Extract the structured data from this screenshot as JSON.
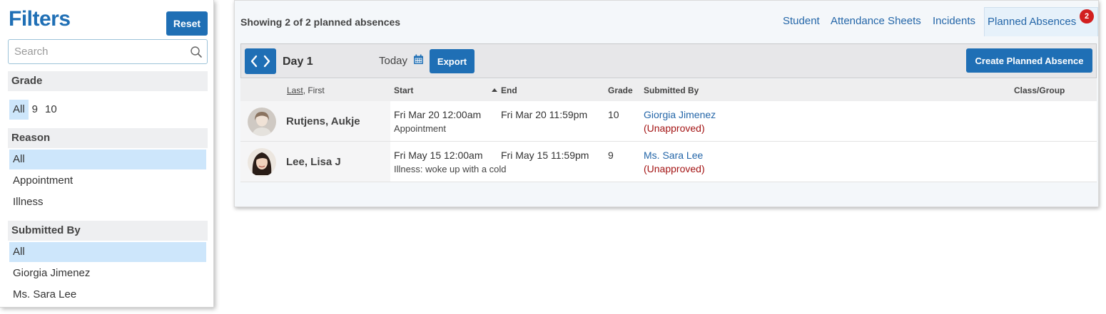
{
  "filters": {
    "title": "Filters",
    "reset_label": "Reset",
    "search_placeholder": "Search",
    "grade": {
      "heading": "Grade",
      "options": [
        "All",
        "9",
        "10"
      ],
      "selected": "All"
    },
    "reason": {
      "heading": "Reason",
      "options": [
        "All",
        "Appointment",
        "Illness"
      ],
      "selected": "All"
    },
    "submitted_by": {
      "heading": "Submitted By",
      "options": [
        "All",
        "Giorgia Jimenez",
        "Ms. Sara Lee"
      ],
      "selected": "All"
    }
  },
  "main": {
    "showing_text": "Showing 2 of 2 planned absences",
    "nav": [
      {
        "label": "Student"
      },
      {
        "label": "Attendance Sheets"
      },
      {
        "label": "Incidents"
      },
      {
        "label": "Planned Absences",
        "badge": "2",
        "active": true
      }
    ],
    "toolbar": {
      "day_label": "Day 1",
      "today_label": "Today",
      "export_label": "Export",
      "create_label": "Create Planned Absence"
    },
    "table": {
      "headers": {
        "last": "Last",
        "first": ", First",
        "start": "Start",
        "end": "End",
        "grade": "Grade",
        "submitted_by": "Submitted By",
        "class_group": "Class/Group"
      },
      "rows": [
        {
          "name": "Rutjens, Aukje",
          "start": "Fri Mar 20 12:00am",
          "end": "Fri Mar 20 11:59pm",
          "reason": "Appointment",
          "grade": "10",
          "submitter": "Giorgia Jimenez",
          "status": "(Unapproved)"
        },
        {
          "name": "Lee, Lisa J",
          "start": "Fri May 15 12:00am",
          "end": "Fri May 15 11:59pm",
          "reason": "Illness: woke up with a cold",
          "grade": "9",
          "submitter": "Ms. Sara Lee",
          "status": "(Unapproved)"
        }
      ]
    }
  },
  "colors": {
    "primary": "#1f6fb5",
    "link": "#2466a8",
    "selected_bg": "#cde6fb",
    "unapproved": "#a41515",
    "badge": "#d21f1f"
  }
}
